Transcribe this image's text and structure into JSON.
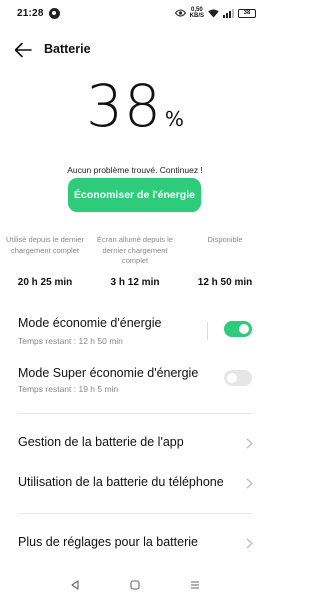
{
  "status_bar": {
    "time": "21:28",
    "speed_value": "0,50",
    "speed_unit": "KB/S",
    "battery_level": "38"
  },
  "header": {
    "title": "Batterie"
  },
  "battery": {
    "percent": "38",
    "percent_sign": "%"
  },
  "status_message": "Aucun problème trouvé. Continuez !",
  "save_button_label": "Économiser de l'énergie",
  "stats": [
    {
      "label": "Utilisé depuis le dernier chargement complet",
      "value": "20 h 25 min"
    },
    {
      "label": "Écran allumé depuis le dernier chargement complet",
      "value": "3 h 12 min"
    },
    {
      "label": "Disponible",
      "value": "12 h 50 min"
    }
  ],
  "modes": [
    {
      "title": "Mode économie d'énergie",
      "subtitle": "Temps restant : 12 h 50 min",
      "enabled": true
    },
    {
      "title": "Mode Super économie d'énergie",
      "subtitle": "Temps restant : 19 h 5 min",
      "enabled": false
    }
  ],
  "menu": [
    {
      "label": "Gestion de la batterie de l'app"
    },
    {
      "label": "Utilisation de la batterie du téléphone"
    },
    {
      "label": "Plus de réglages pour la batterie"
    }
  ],
  "colors": {
    "accent": "#2ecc7a",
    "text_primary": "#111111",
    "text_secondary": "#888888"
  },
  "icons": {
    "back": "back-arrow-icon",
    "chevron": "chevron-right-icon",
    "nav_back": "nav-back-icon",
    "nav_home": "nav-home-icon",
    "nav_recents": "nav-recents-icon"
  }
}
